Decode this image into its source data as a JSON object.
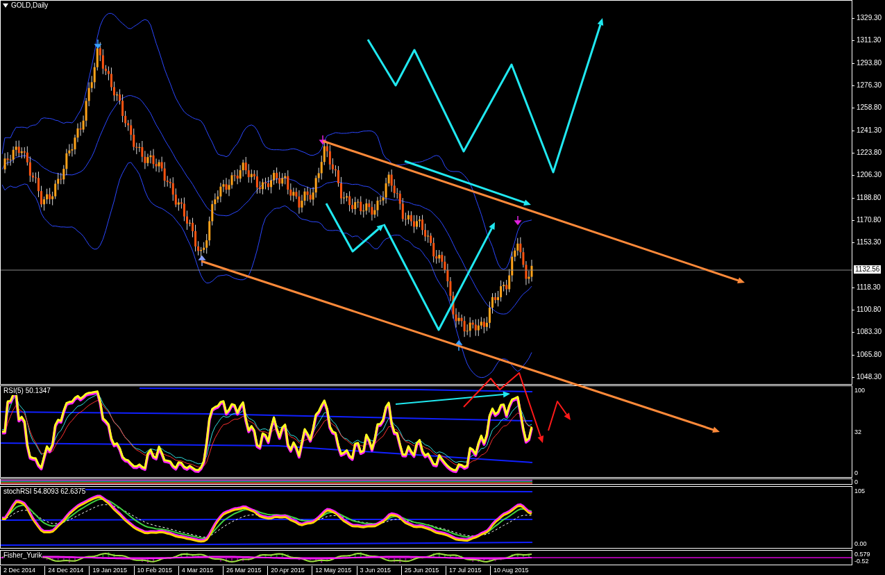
{
  "chart": {
    "title": "GOLD,Daily",
    "current_price": "1132.56",
    "price_labels": [
      "1329.30",
      "1311.30",
      "1293.80",
      "1276.30",
      "1258.80",
      "1241.30",
      "1223.80",
      "1206.30",
      "1188.80",
      "1170.80",
      "1153.30",
      "1118.30",
      "1100.80",
      "1083.30",
      "1065.80",
      "1048.30"
    ]
  },
  "indicators": [
    {
      "kind": "rsi",
      "label": "RSI(5) 50.1347",
      "scale_labels": [
        "100",
        "32",
        "0"
      ]
    },
    {
      "kind": "strip",
      "scale_labels": [
        "0"
      ]
    },
    {
      "kind": "stoch",
      "label": "stochRSI 54.8093 62.6375",
      "scale_labels": [
        "105",
        "0.00"
      ]
    },
    {
      "kind": "fisher",
      "label": "Fisher_Yurik",
      "scale_labels": [
        "0.579",
        "-0.52"
      ]
    }
  ],
  "time_labels": [
    "2 Dec 2014",
    "24 Dec 2014",
    "19 Jan 2015",
    "10 Feb 2015",
    "4 Mar 2015",
    "26 Mar 2015",
    "20 Apr 2015",
    "12 May 2015",
    "3 Jun 2015",
    "25 Jun 2015",
    "17 Jul 2015",
    "10 Aug 2015"
  ]
}
